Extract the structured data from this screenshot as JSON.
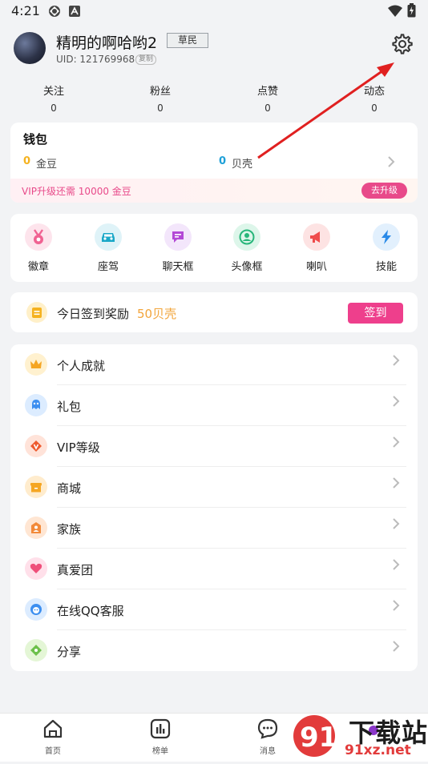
{
  "status_bar": {
    "time": "4:21"
  },
  "profile": {
    "nickname": "精明的啊哈哟2",
    "rank": "草民",
    "uid": "UID: 121769968",
    "copy_label": "复制"
  },
  "stats": [
    {
      "label": "关注",
      "value": "0"
    },
    {
      "label": "粉丝",
      "value": "0"
    },
    {
      "label": "点赞",
      "value": "0"
    },
    {
      "label": "动态",
      "value": "0"
    }
  ],
  "wallet": {
    "title": "钱包",
    "gold_value": "0",
    "gold_label": "金豆",
    "shell_value": "0",
    "shell_label": "贝壳",
    "vip_text": "VIP升级还需 10000 金豆",
    "upgrade_label": "去升级"
  },
  "features": [
    {
      "label": "徽章",
      "icon": "badge-icon"
    },
    {
      "label": "座驾",
      "icon": "car-icon"
    },
    {
      "label": "聊天框",
      "icon": "chat-frame-icon"
    },
    {
      "label": "头像框",
      "icon": "avatar-frame-icon"
    },
    {
      "label": "喇叭",
      "icon": "speaker-icon"
    },
    {
      "label": "技能",
      "icon": "lightning-icon"
    }
  ],
  "signin": {
    "text": "今日签到奖励",
    "reward": "50贝壳",
    "button": "签到"
  },
  "menu": [
    {
      "label": "个人成就",
      "icon": "crown-icon"
    },
    {
      "label": "礼包",
      "icon": "gift-pack-icon"
    },
    {
      "label": "VIP等级",
      "icon": "vip-icon"
    },
    {
      "label": "商城",
      "icon": "shop-icon"
    },
    {
      "label": "家族",
      "icon": "family-icon"
    },
    {
      "label": "真爱团",
      "icon": "heart-group-icon"
    },
    {
      "label": "在线QQ客服",
      "icon": "qq-service-icon"
    },
    {
      "label": "分享",
      "icon": "share-icon"
    }
  ],
  "bottom_nav": [
    {
      "label": "首页",
      "icon": "home-icon"
    },
    {
      "label": "榜单",
      "icon": "ranking-icon"
    },
    {
      "label": "消息",
      "icon": "message-icon"
    }
  ],
  "watermark": {
    "brand": "下载站",
    "url": "91xz.net",
    "number": "91"
  },
  "colors": {
    "accent_pink": "#ee3f8c",
    "gold": "#f5b21f",
    "shell_blue": "#1ea0d8",
    "annotation_red": "#e02020"
  }
}
